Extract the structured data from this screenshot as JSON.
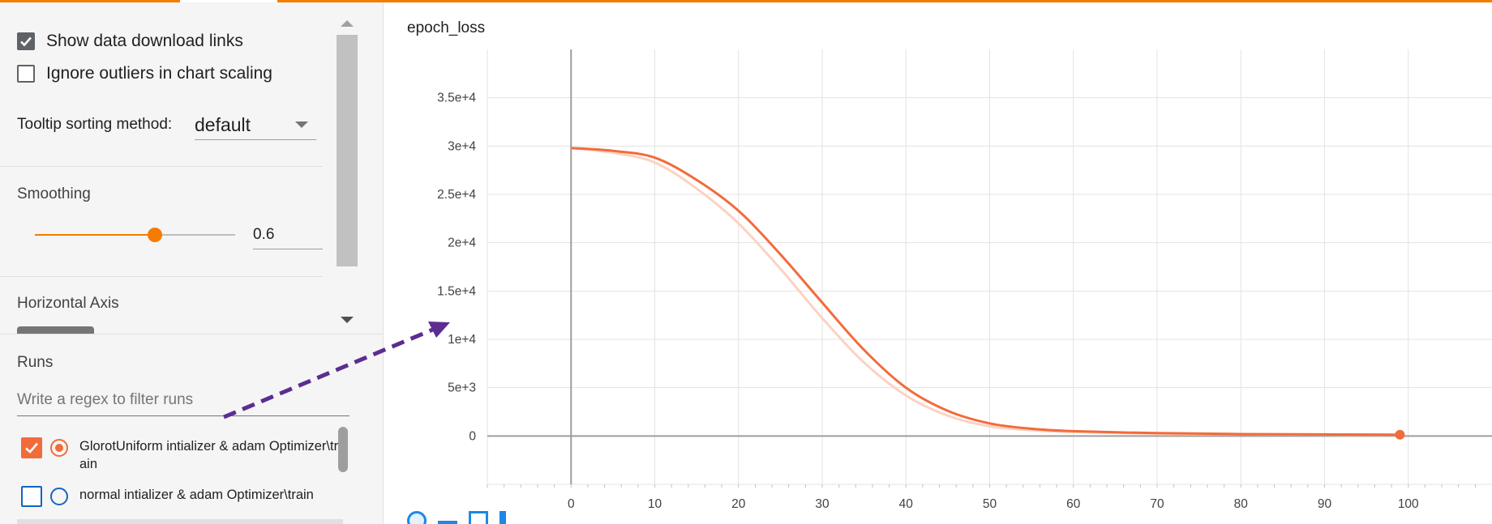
{
  "settings": {
    "show_download_links": {
      "label": "Show data download links",
      "checked": true
    },
    "ignore_outliers": {
      "label": "Ignore outliers in chart scaling",
      "checked": false
    },
    "tooltip_sorting": {
      "label": "Tooltip sorting method:",
      "value": "default"
    },
    "smoothing": {
      "label": "Smoothing",
      "value": "0.6",
      "level": 0.6
    },
    "horizontal_axis": {
      "label": "Horizontal Axis"
    }
  },
  "runs": {
    "title": "Runs",
    "filter_placeholder": "Write a regex to filter runs",
    "items": [
      {
        "label": "GlorotUniform intializer & adam Optimizer\\train",
        "checked": true,
        "color": "#f26b3a"
      },
      {
        "label": "normal intializer & adam Optimizer\\train",
        "checked": false,
        "color": "#1565c0"
      }
    ]
  },
  "chart": {
    "title": "epoch_loss"
  },
  "chart_data": {
    "type": "line",
    "title": "epoch_loss",
    "xlabel": "",
    "ylabel": "",
    "xlim": [
      -10,
      110
    ],
    "ylim": [
      -5000,
      40000
    ],
    "x_ticks": [
      0,
      10,
      20,
      30,
      40,
      50,
      60,
      70,
      80,
      90,
      100
    ],
    "y_ticks": [
      0,
      5000,
      10000,
      15000,
      20000,
      25000,
      30000,
      35000
    ],
    "y_tick_labels": [
      "0",
      "5e+3",
      "1e+4",
      "1.5e+4",
      "2e+4",
      "2.5e+4",
      "3e+4",
      "3.5e+4"
    ],
    "grid": true,
    "series": [
      {
        "name": "GlorotUniform intializer & adam Optimizer\\train",
        "color": "#f26b3a",
        "x": [
          0,
          5,
          10,
          15,
          20,
          25,
          30,
          35,
          40,
          45,
          50,
          55,
          60,
          70,
          80,
          90,
          99
        ],
        "values": [
          29800,
          29500,
          28800,
          26500,
          23300,
          18800,
          13800,
          8900,
          5000,
          2600,
          1300,
          750,
          500,
          300,
          200,
          160,
          130
        ]
      }
    ],
    "raw_series": {
      "color": "#fcd2c2",
      "x": [
        0,
        5,
        10,
        15,
        20,
        25,
        30,
        35,
        40,
        45,
        50,
        55,
        60,
        70,
        80,
        90,
        99
      ],
      "values": [
        29800,
        29300,
        28300,
        25600,
        22000,
        17300,
        12200,
        7600,
        4200,
        2100,
        1000,
        600,
        400,
        250,
        180,
        140,
        120
      ]
    }
  },
  "arrow": {
    "color": "#5c2d91"
  }
}
